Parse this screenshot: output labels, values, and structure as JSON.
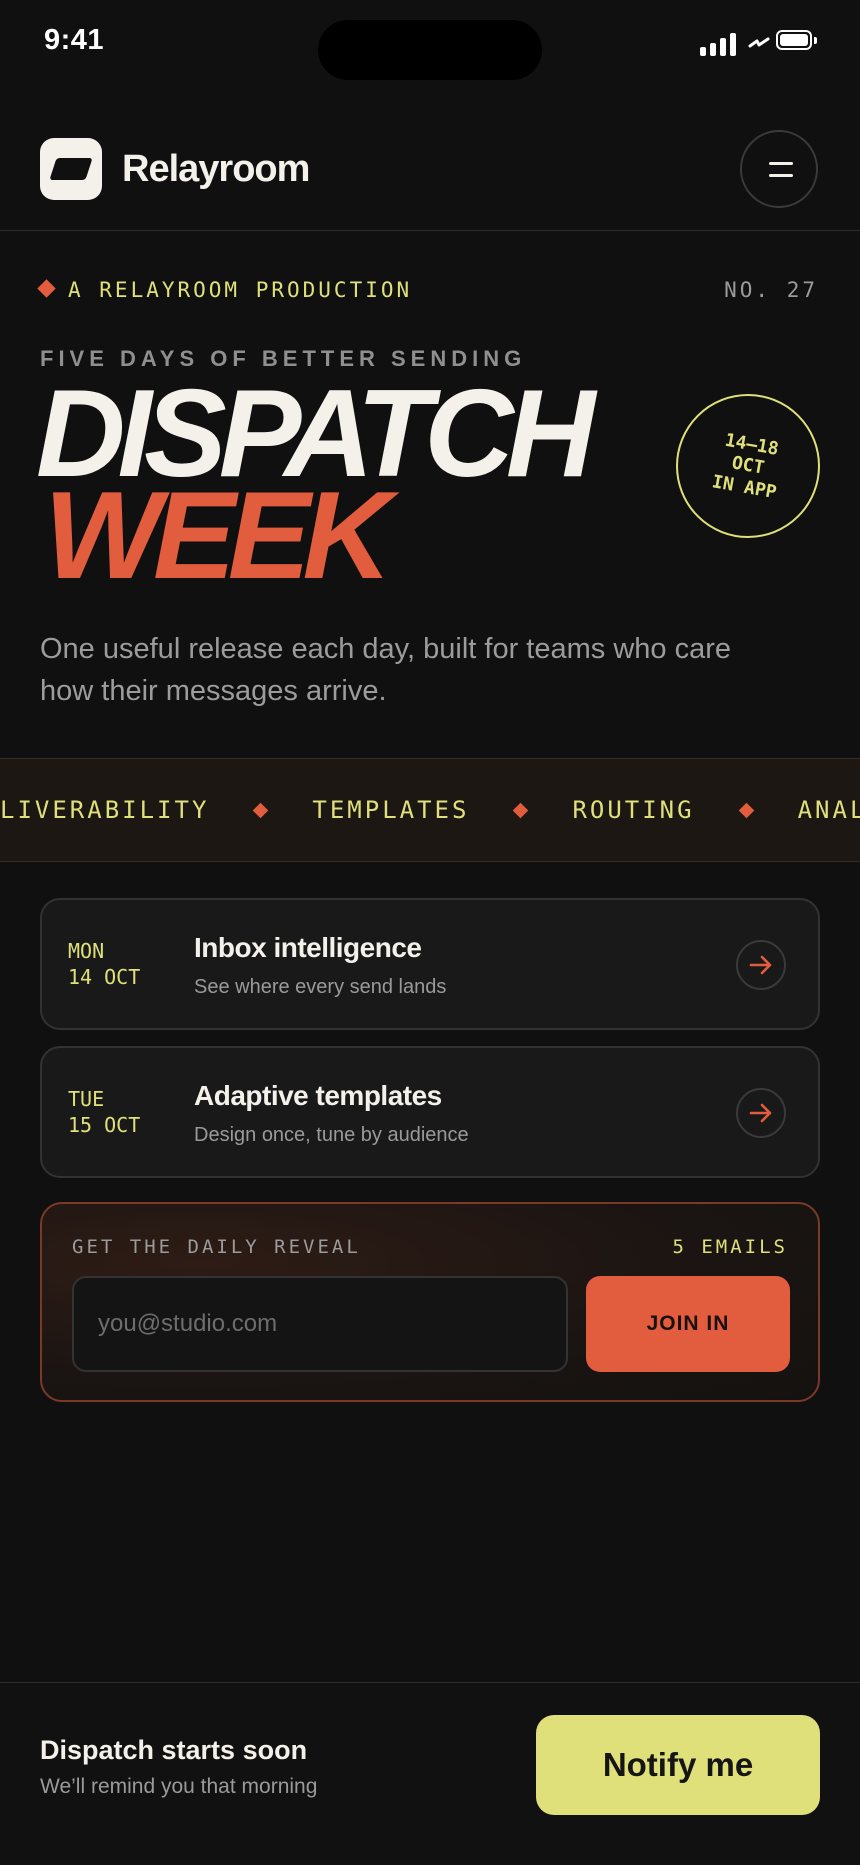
{
  "status_bar": {
    "time": "9:41"
  },
  "header": {
    "brand": "Relayroom"
  },
  "hero": {
    "eyebrow": "A RELAYROOM PRODUCTION",
    "issue": "NO. 27",
    "kicker": "FIVE DAYS OF BETTER SENDING",
    "title_line1": "DISPATCH",
    "title_line2": "WEEK",
    "date_badge": {
      "line1": "14–18",
      "line2": "OCT",
      "line3": "IN APP"
    },
    "lede": "One useful release each day, built for teams who care how their messages arrive."
  },
  "ticker": {
    "items": [
      "LIVERABILITY",
      "TEMPLATES",
      "ROUTING",
      "ANALYTI"
    ]
  },
  "schedule": [
    {
      "weekday": "MON",
      "date": "14 OCT",
      "title": "Inbox intelligence",
      "subtitle": "See where every send lands"
    },
    {
      "weekday": "TUE",
      "date": "15 OCT",
      "title": "Adaptive templates",
      "subtitle": "Design once, tune by audience"
    }
  ],
  "signup": {
    "label": "GET THE DAILY REVEAL",
    "count": "5 EMAILS",
    "email_placeholder": "you@studio.com",
    "button": "JOIN IN"
  },
  "bottom_bar": {
    "title": "Dispatch starts soon",
    "subtitle": "We’ll remind you that morning",
    "button": "Notify me"
  },
  "colors": {
    "accent": "#e25c3e",
    "highlight": "#dfe07a",
    "background": "#101010"
  }
}
